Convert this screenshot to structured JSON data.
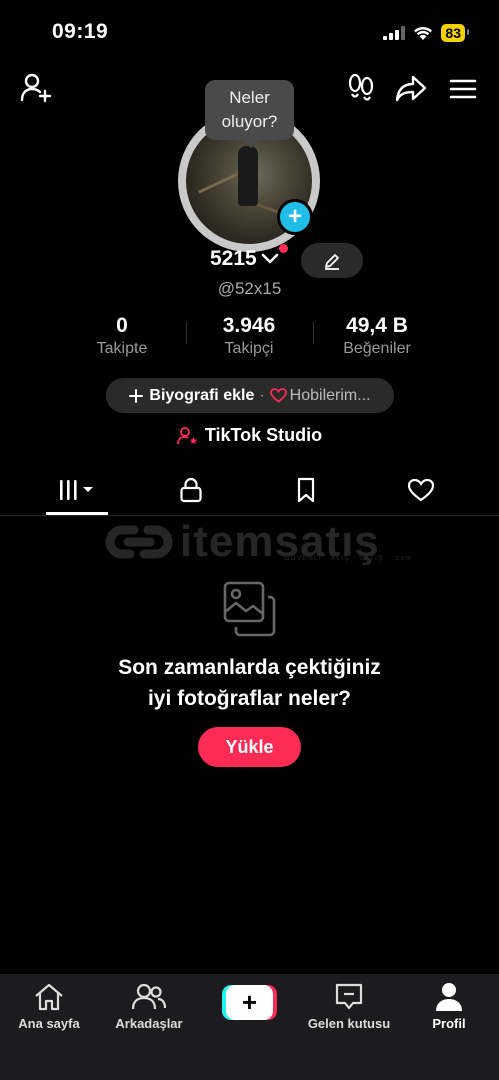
{
  "status": {
    "time": "09:19",
    "battery": "83"
  },
  "tooltip": {
    "line1": "Neler",
    "line2": "oluyor?"
  },
  "profile": {
    "name": "5215",
    "handle": "@52x15",
    "stats": [
      {
        "value": "0",
        "label": "Takipte"
      },
      {
        "value": "3.946",
        "label": "Takipçi"
      },
      {
        "value": "49,4 B",
        "label": "Beğeniler"
      }
    ],
    "bio_add": "Biyografi ekle",
    "bio_sep": "·",
    "hobbies": "Hobilerim...",
    "studio": "TikTok Studio"
  },
  "watermark": {
    "text": "itemsatış",
    "sub": "GÜVENLİ · ALIŞ · SATIŞ · .com"
  },
  "empty": {
    "line1": "Son zamanlarda çektiğiniz",
    "line2": "iyi fotoğraflar neler?",
    "button": "Yükle"
  },
  "nav": {
    "home": "Ana sayfa",
    "friends": "Arkadaşlar",
    "inbox": "Gelen kutusu",
    "profile": "Profil"
  },
  "colors": {
    "accent": "#fe2c55",
    "cyan": "#25f4ee",
    "badge": "#20bde6"
  }
}
